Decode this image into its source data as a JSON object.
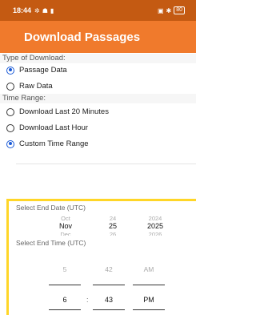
{
  "status": {
    "time": "18:44",
    "left_icons": [
      "✲",
      "☗",
      "▮"
    ],
    "right_icons": [
      "▣",
      "✱"
    ],
    "battery_label": "80"
  },
  "app": {
    "title": "Download Passages"
  },
  "download_type": {
    "label": "Type of Download:",
    "options": [
      {
        "label": "Passage Data",
        "selected": true
      },
      {
        "label": "Raw Data",
        "selected": false
      }
    ]
  },
  "time_range": {
    "label": "Time Range:",
    "options": [
      {
        "label": "Download Last 20 Minutes",
        "selected": false
      },
      {
        "label": "Download Last Hour",
        "selected": false
      },
      {
        "label": "Custom Time Range",
        "selected": true
      }
    ]
  },
  "end_date": {
    "label": "Select End Date (UTC)",
    "month": {
      "prev": "Oct",
      "current": "Nov",
      "next": "Dec"
    },
    "day": {
      "prev": "24",
      "current": "25",
      "next": "26"
    },
    "year": {
      "prev": "2024",
      "current": "2025",
      "next": "2026"
    }
  },
  "end_time": {
    "label": "Select End Time (UTC)",
    "hour": {
      "prev": "5",
      "current": "6"
    },
    "minute": {
      "prev": "42",
      "current": "43"
    },
    "ampm": {
      "prev": "AM",
      "current": "PM"
    },
    "separator": ":"
  },
  "colors": {
    "status_bar": "#c45a12",
    "app_bar": "#f07a2c",
    "radio_selected": "#1a5ad6",
    "highlight_border": "#ffd628"
  }
}
